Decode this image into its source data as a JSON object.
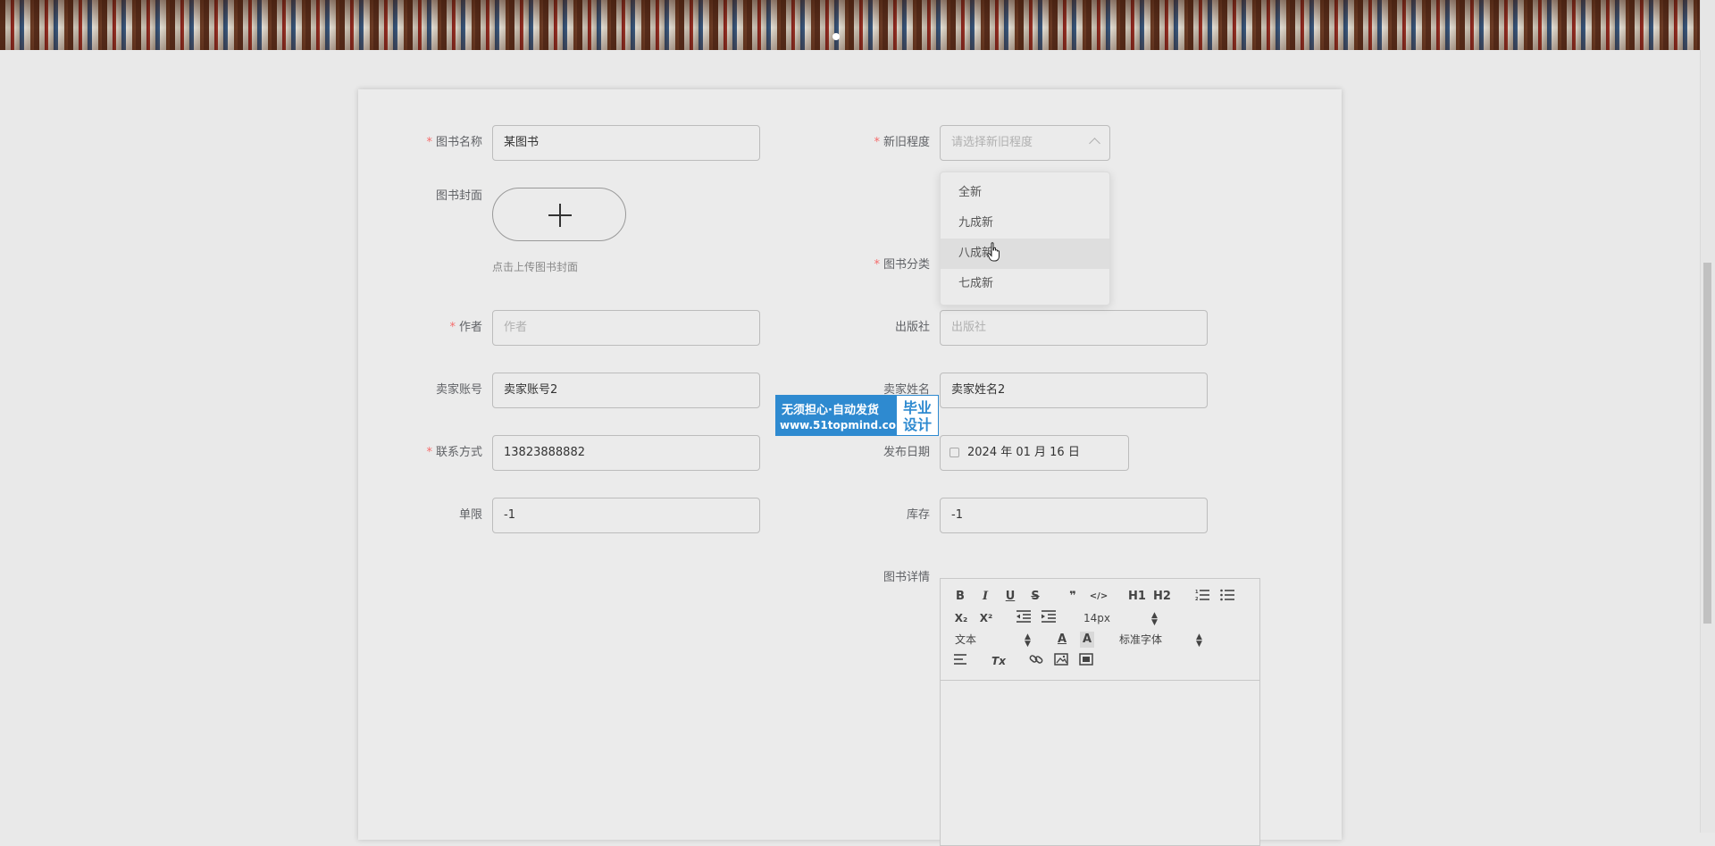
{
  "form": {
    "book_name": {
      "label": "图书名称",
      "value": "某图书"
    },
    "condition": {
      "label": "新旧程度",
      "placeholder": "请选择新旧程度",
      "options": [
        "全新",
        "九成新",
        "八成新",
        "七成新"
      ],
      "hovered_option": "八成新"
    },
    "cover": {
      "label": "图书封面",
      "hint": "点击上传图书封面"
    },
    "category": {
      "label": "图书分类"
    },
    "author": {
      "label": "作者",
      "placeholder": "作者"
    },
    "publisher": {
      "label": "出版社",
      "placeholder": "出版社"
    },
    "seller_account": {
      "label": "卖家账号",
      "value": "卖家账号2"
    },
    "seller_name": {
      "label": "卖家姓名",
      "value": "卖家姓名2"
    },
    "contact": {
      "label": "联系方式",
      "value": "13823888882"
    },
    "publish_date": {
      "label": "发布日期",
      "value": "2024 年 01 月 16 日"
    },
    "limit": {
      "label": "单限",
      "value": "-1"
    },
    "stock": {
      "label": "库存",
      "value": "-1"
    },
    "details": {
      "label": "图书详情"
    }
  },
  "editor": {
    "size_select": "14px",
    "header_select": "文本",
    "font_select": "标准字体",
    "buttons": {
      "bold": "B",
      "italic": "I",
      "underline": "U",
      "strike": "S",
      "blockquote": "❞",
      "code": "</>",
      "h1": "H1",
      "h2": "H2",
      "sub": "X₂",
      "sup": "X²",
      "color": "A",
      "background": "A",
      "clean": "Tx"
    }
  },
  "watermark": {
    "line1": "无须担心·自动发货",
    "line2": "www.51topmind.com",
    "badge_line1": "毕业",
    "badge_line2": "设计"
  },
  "colors": {
    "required_star": "#f56c6c",
    "watermark_blue": "#2e8ad0",
    "page_bg": "#e9e9e9"
  }
}
